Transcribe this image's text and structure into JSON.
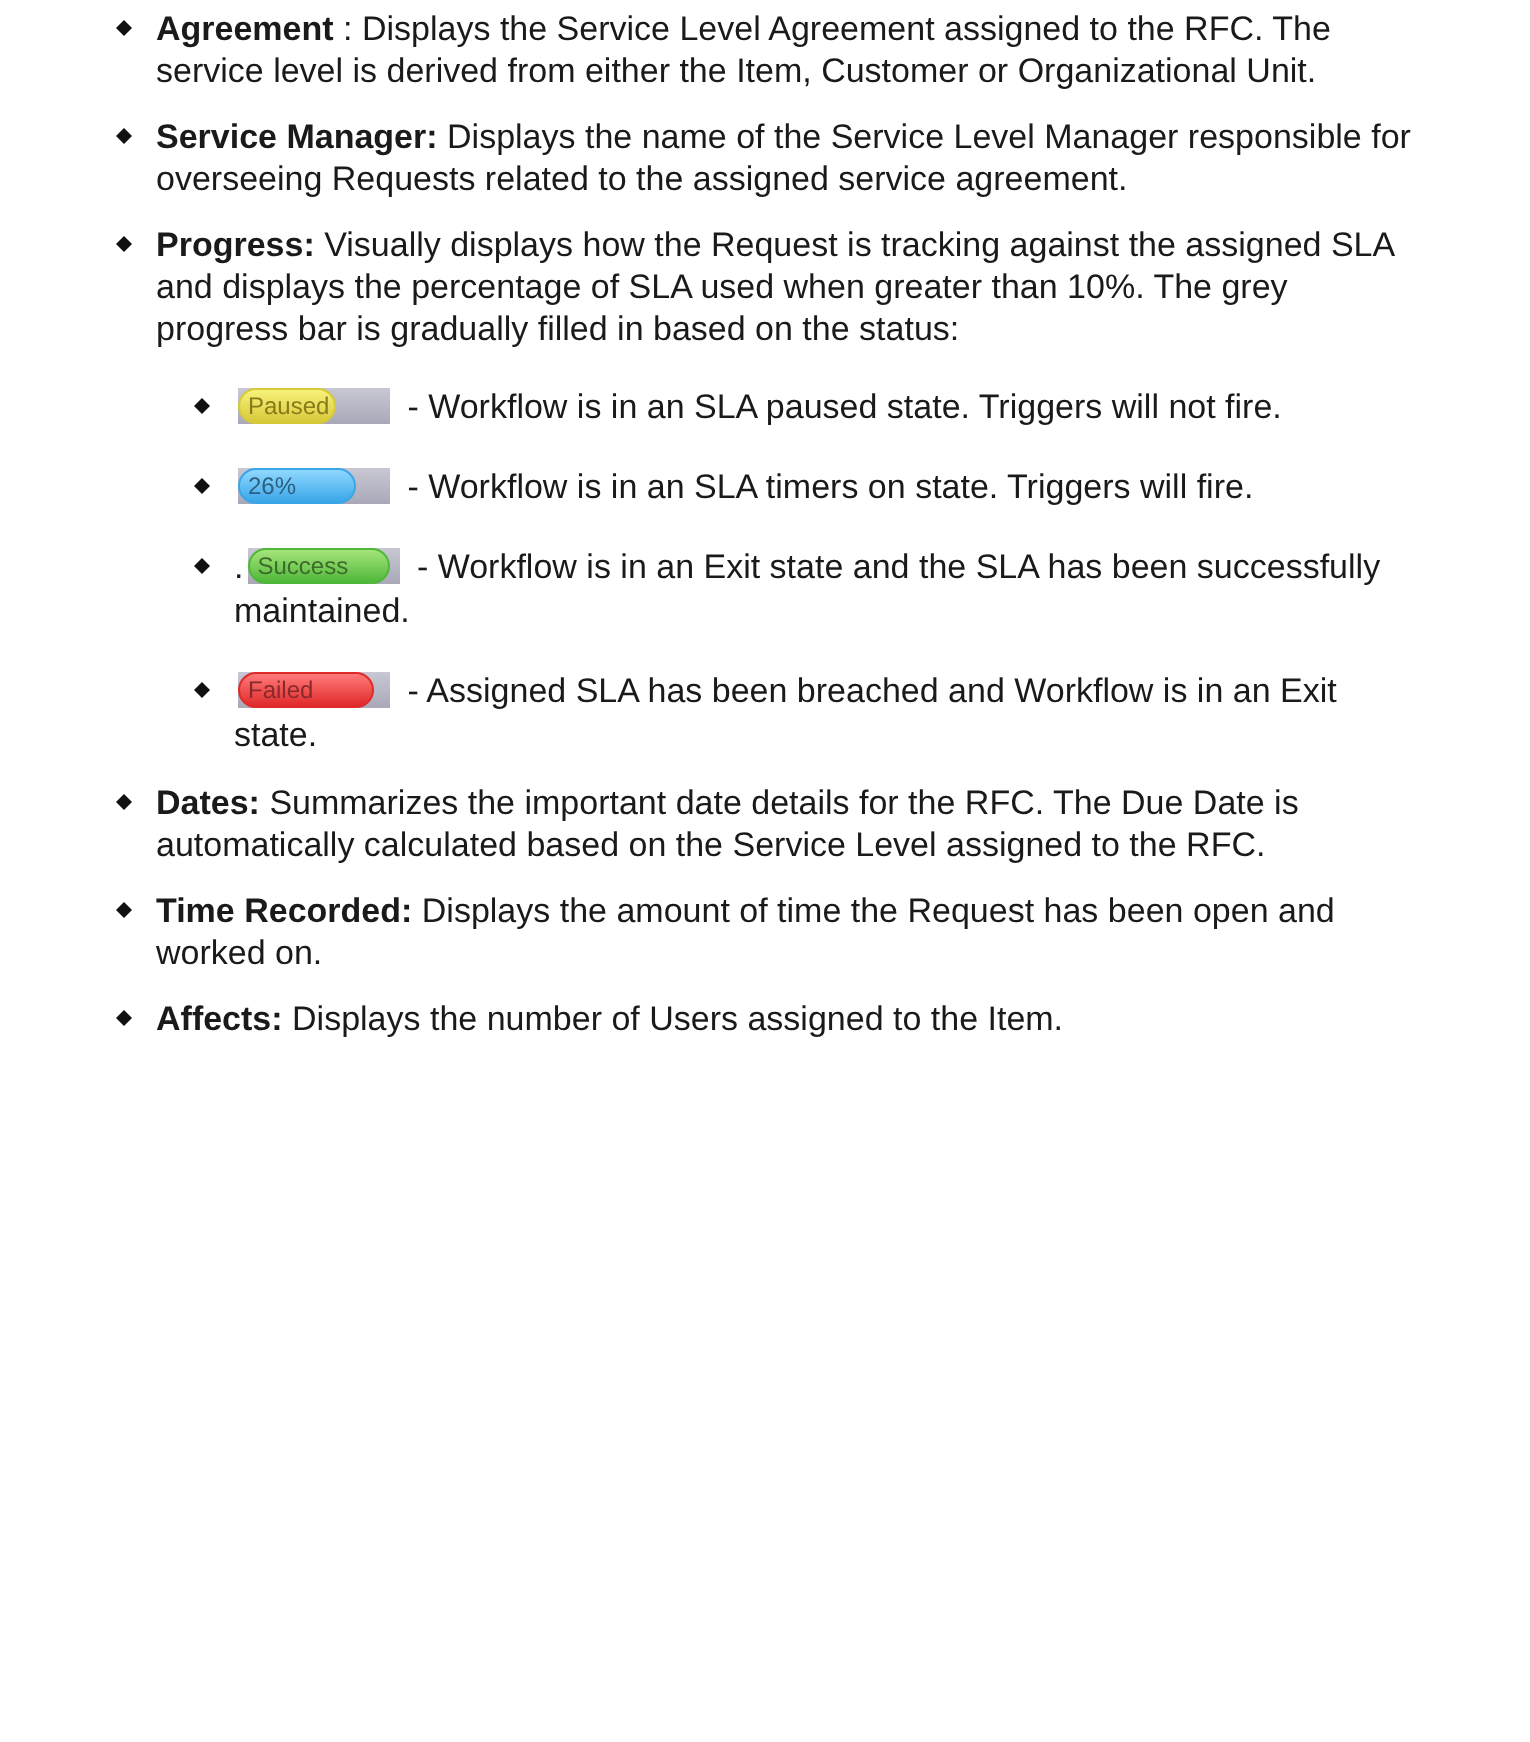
{
  "items": [
    {
      "text": "**Agreement** : Displays the Service Level Agreement assigned to the RFC. The service level is derived from either the Item, Customer or Organizational Unit."
    },
    {
      "text": "**Service Manager:** Displays the name of the Service Level Manager responsible for overseeing Requests related to the assigned service agreement."
    },
    {
      "text": "**Progress:** Visually displays how the Request is tracking against the assigned SLA and displays the percentage of SLA used when greater than 10%. The grey progress bar is gradually filled in based on the status:",
      "children": [
        {
          "kind": "paused",
          "badge": "Paused",
          "level": 0.65,
          "text": "- Workflow is in an SLA paused state. Triggers will not fire."
        },
        {
          "kind": "progress",
          "badge": "26%",
          "level": 0.78,
          "text": "- Workflow is in an SLA timers on state. Triggers will fire."
        },
        {
          "kind": "success",
          "prefix": ".",
          "badge": "Success",
          "level": 0.94,
          "text": "- Workflow is in an Exit state and the SLA has been successfully maintained."
        },
        {
          "kind": "failed",
          "badge": "Failed",
          "level": 0.9,
          "text": "- Assigned SLA has been breached and Workflow is in an Exit state."
        }
      ]
    },
    {
      "text": "**Dates:** Summarizes the important date details for the RFC. The Due Date is automatically calculated based on the Service Level assigned to the RFC."
    },
    {
      "text": "**Time Recorded:** Displays the amount of time the Request has been open and worked on."
    },
    {
      "text": "**Affects:** Displays the number of Users assigned to the Item."
    }
  ]
}
